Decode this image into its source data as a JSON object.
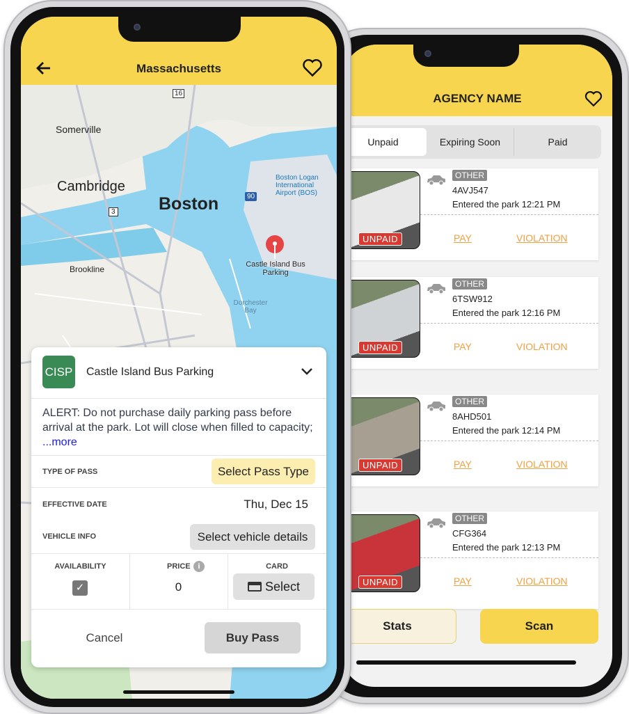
{
  "agency_app": {
    "title": "AGENCY NAME",
    "tabs": [
      {
        "label": "Unpaid",
        "active": true
      },
      {
        "label": "Expiring Soon"
      },
      {
        "label": "Paid"
      }
    ],
    "vehicles": [
      {
        "type": "OTHER",
        "plate": "4AVJ547",
        "entered": "Entered the park 12:21 PM",
        "status": "UNPAID",
        "pay": "PAY",
        "violation": "VIOLATION",
        "photo_color": "#e8e8e8"
      },
      {
        "type": "OTHER",
        "plate": "6TSW912",
        "entered": "Entered the park 12:16 PM",
        "status": "UNPAID",
        "pay": "PAY",
        "violation": "VIOLATION",
        "photo_color": "#cfd3d6"
      },
      {
        "type": "OTHER",
        "plate": "8AHD501",
        "entered": "Entered the park 12:14 PM",
        "status": "UNPAID",
        "pay": "PAY",
        "violation": "VIOLATION",
        "photo_color": "#a7a092"
      },
      {
        "type": "OTHER",
        "plate": "CFG364",
        "entered": "Entered the park 12:13 PM",
        "status": "UNPAID",
        "pay": "PAY",
        "violation": "VIOLATION",
        "photo_color": "#c9343a"
      }
    ],
    "stats_label": "Stats",
    "scan_label": "Scan"
  },
  "parking_app": {
    "title": "Massachusetts",
    "map_labels": {
      "somerville": "Somerville",
      "cambridge": "Cambridge",
      "boston": "Boston",
      "brookline": "Brookline",
      "airport": "Boston Logan International Airport (BOS)",
      "pin": "Castle Island Bus Parking",
      "bay": "Dorchester Bay",
      "route16": "16",
      "route3": "3",
      "route90": "90"
    },
    "lot": {
      "badge": "CISP",
      "name": "Castle Island Bus Parking",
      "badge_color": "#3a8a55"
    },
    "alert": "ALERT: Do not purchase daily parking pass before arrival at the park. Lot will close when filled to capacity; ",
    "more": "...more",
    "type_of_pass_label": "TYPE OF PASS",
    "type_of_pass_value": "Select Pass Type",
    "effective_date_label": "EFFECTIVE DATE",
    "effective_date_value": "Thu, Dec 15",
    "vehicle_info_label": "VEHICLE INFO",
    "vehicle_info_value": "Select vehicle details",
    "availability_label": "AVAILABILITY",
    "availability_checked": true,
    "price_label": "PRICE",
    "price_value": "0",
    "card_label": "CARD",
    "card_value": "Select",
    "cancel": "Cancel",
    "buy": "Buy Pass"
  }
}
